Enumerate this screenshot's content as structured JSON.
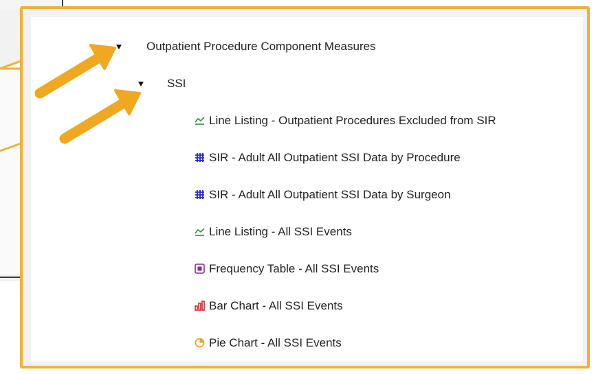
{
  "tree": {
    "root": {
      "label": "Outpatient Procedure Component Measures",
      "expanded": true
    },
    "child": {
      "label": "SSI",
      "expanded": true
    },
    "items": [
      {
        "label": "Line Listing - Outpatient Procedures Excluded from SIR",
        "icon": "line-chart-icon",
        "color": "#2e8b3e"
      },
      {
        "label": "SIR - Adult All Outpatient SSI Data by Procedure",
        "icon": "grid-table-icon",
        "color": "#2727c9"
      },
      {
        "label": "SIR - Adult All Outpatient SSI Data by Surgeon",
        "icon": "grid-table-icon",
        "color": "#2727c9"
      },
      {
        "label": "Line Listing - All SSI Events",
        "icon": "line-chart-icon",
        "color": "#2e8b3e"
      },
      {
        "label": "Frequency Table - All SSI Events",
        "icon": "frequency-table-icon",
        "color": "#8b2a9a"
      },
      {
        "label": "Bar Chart - All SSI Events",
        "icon": "bar-chart-icon",
        "color": "#d8252b"
      },
      {
        "label": "Pie Chart - All SSI Events",
        "icon": "pie-chart-icon",
        "color": "#f2a32b"
      }
    ]
  },
  "colors": {
    "border": "#f0b13c",
    "arrow": "#f0a820"
  }
}
